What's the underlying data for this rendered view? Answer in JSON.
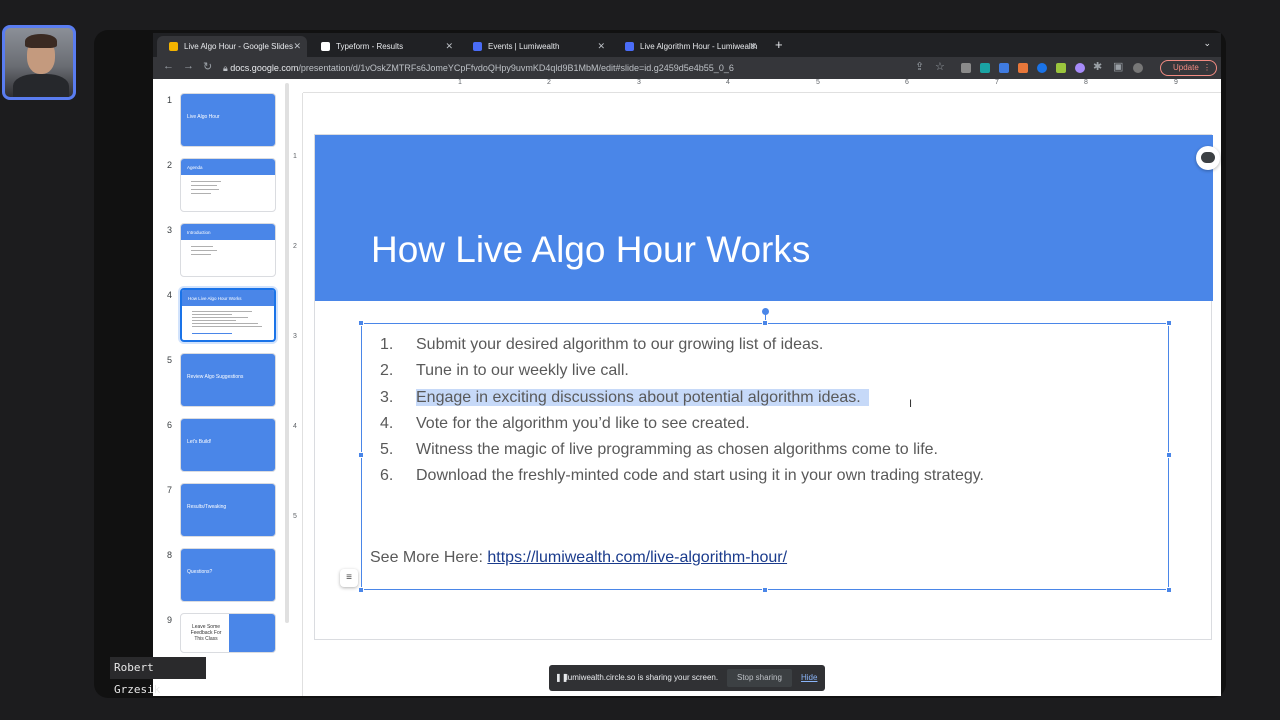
{
  "participant": {
    "name": "Robert Grzesik"
  },
  "browser": {
    "tabs": [
      {
        "label": "Live Algo Hour - Google Slides",
        "color": "#f4b400"
      },
      {
        "label": "Typeform - Results",
        "color": "#ffffff"
      },
      {
        "label": "Events | Lumiwealth",
        "color": "#4a6cf7"
      },
      {
        "label": "Live Algorithm Hour - Lumiwealth",
        "color": "#4a6cf7"
      }
    ],
    "new_tab": "+",
    "url_host": "docs.google.com",
    "url_path": "/presentation/d/1vOskZMTRFs6JomeYCpFfvdoQHpy9uvmKD4qld9B1MbM/edit#slide=id.g2459d5e4b55_0_6",
    "update_label": "Update"
  },
  "filmstrip": {
    "thumbs": [
      {
        "num": "1",
        "title": "Live Algo Hour"
      },
      {
        "num": "2",
        "title": "Agenda"
      },
      {
        "num": "3",
        "title": "Introduction"
      },
      {
        "num": "4",
        "title": "How Live Algo Hour Works"
      },
      {
        "num": "5",
        "title": "Review Algo Suggestions"
      },
      {
        "num": "6",
        "title": "Let's Build!"
      },
      {
        "num": "7",
        "title": "Results/Tweaking"
      },
      {
        "num": "8",
        "title": "Questions?"
      },
      {
        "num": "9",
        "title": "Leave Some Feedback For This Class"
      }
    ]
  },
  "ruler": {
    "top": [
      "1",
      "2",
      "3",
      "4",
      "5",
      "6",
      "7",
      "8",
      "9"
    ],
    "left": [
      "1",
      "2",
      "3",
      "4",
      "5"
    ]
  },
  "slide": {
    "title": "How Live Algo Hour Works",
    "items": [
      {
        "num": "1.",
        "text": "Submit your desired algorithm to our growing list of ideas."
      },
      {
        "num": "2.",
        "text": "Tune in to our weekly live call."
      },
      {
        "num": "3.",
        "text": "Engage in exciting discussions about potential algorithm ideas."
      },
      {
        "num": "4.",
        "text": "Vote for the algorithm you’d like to see created."
      },
      {
        "num": "5.",
        "text": "Witness the magic of live programming as chosen algorithms come to life."
      },
      {
        "num": "6.",
        "text": "Download the freshly-minted code and start using it in your own trading strategy."
      }
    ],
    "see_more_label": "See More Here: ",
    "see_more_link": "https://lumiwealth.com/live-algorithm-hour/",
    "header_color": "#4a86e8"
  },
  "sharebar": {
    "message": "lumiwealth.circle.so is sharing your screen.",
    "stop_label": "Stop sharing",
    "hide_label": "Hide"
  }
}
